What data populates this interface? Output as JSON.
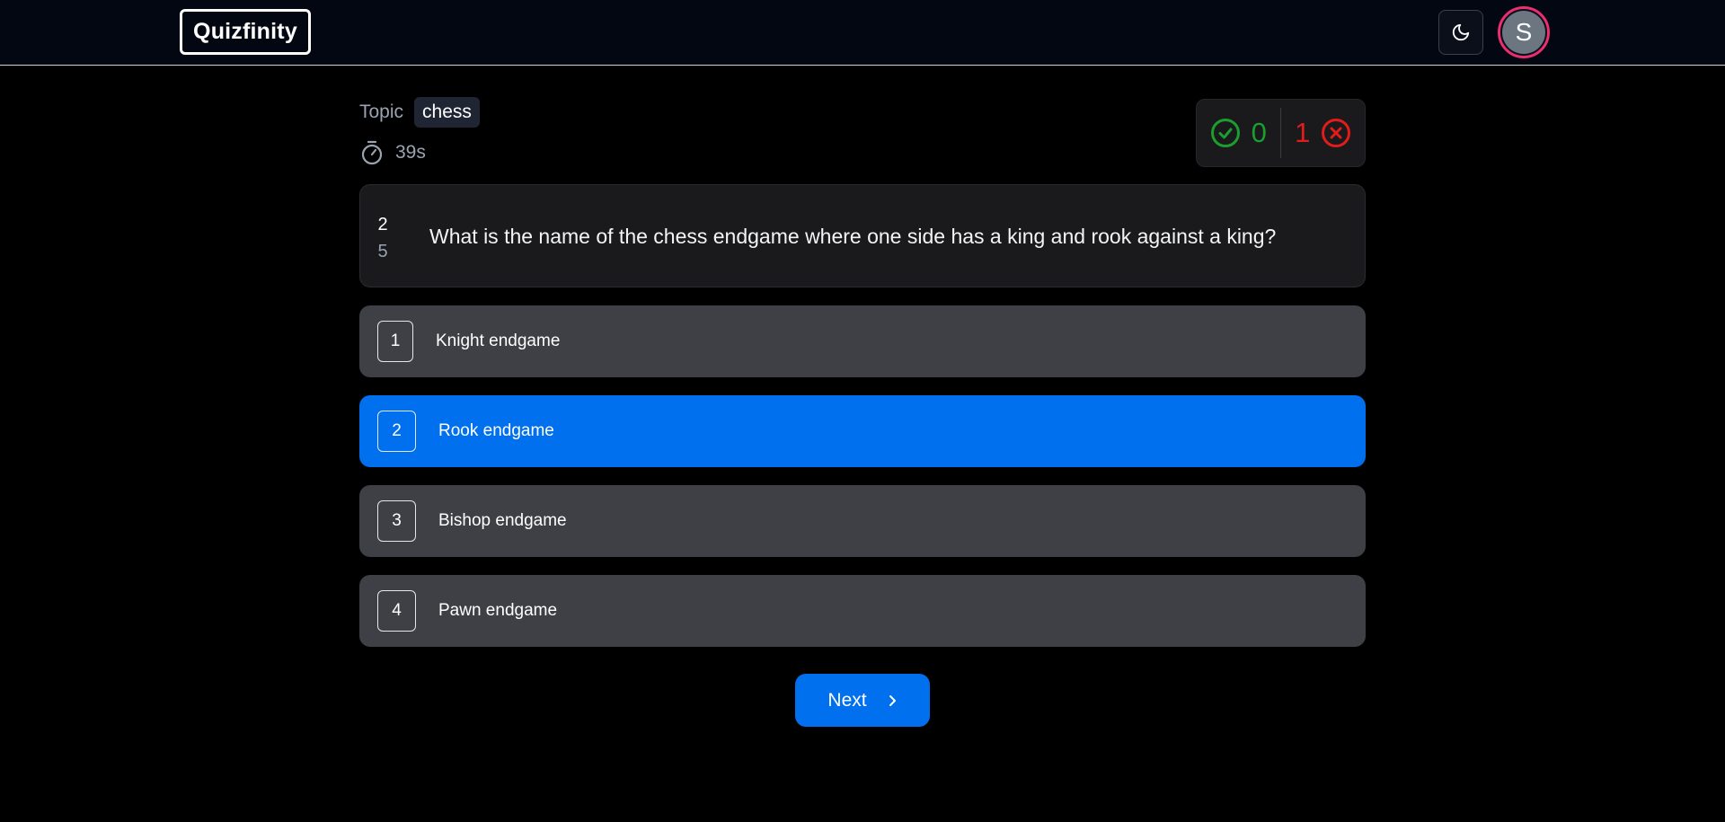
{
  "header": {
    "logo": "Quizfinity",
    "theme_toggle_icon": "moon-icon",
    "avatar_initial": "S",
    "avatar_ring_color": "#ec2d6f"
  },
  "quiz": {
    "topic_label": "Topic",
    "topic": "chess",
    "timer_icon": "stopwatch-icon",
    "timer": "39s",
    "score": {
      "correct_icon": "check-circle-icon",
      "correct": "0",
      "correct_color": "#1a9e2e",
      "wrong": "1",
      "wrong_icon": "x-circle-icon",
      "wrong_color": "#e21b1b"
    },
    "question": {
      "current": "2",
      "total": "5",
      "text": "What is the name of the chess endgame where one side has a king and rook against a king?"
    },
    "options": [
      {
        "number": "1",
        "label": "Knight endgame",
        "selected": false
      },
      {
        "number": "2",
        "label": "Rook endgame",
        "selected": true
      },
      {
        "number": "3",
        "label": "Bishop endgame",
        "selected": false
      },
      {
        "number": "4",
        "label": "Pawn endgame",
        "selected": false
      }
    ],
    "next_button": "Next",
    "next_icon": "chevron-right-icon",
    "accent_color": "#0070ef"
  }
}
